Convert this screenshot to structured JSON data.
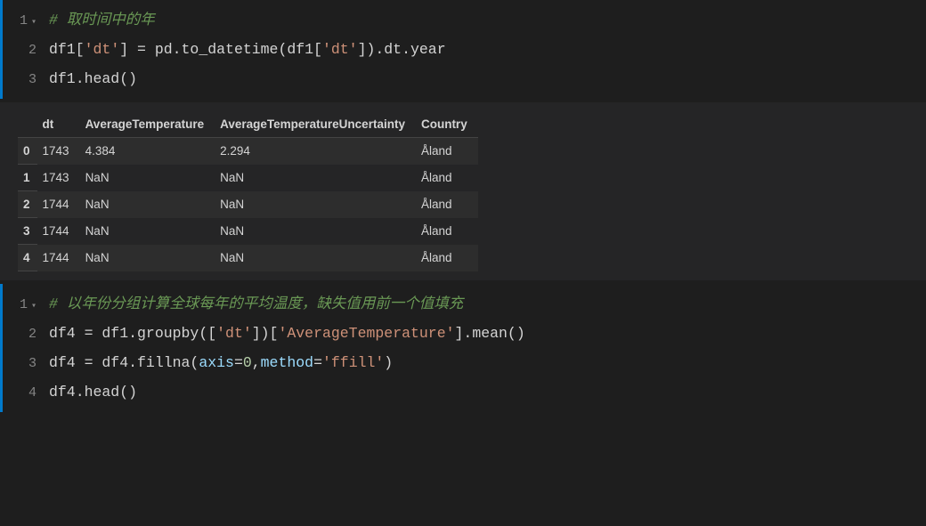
{
  "cell1": {
    "lines": [
      {
        "n": "1",
        "fold": "▾",
        "tokens": [
          {
            "cls": "c-comment",
            "t": "# 取时间中的年"
          }
        ]
      },
      {
        "n": "2",
        "fold": "",
        "tokens": [
          {
            "cls": "c-text",
            "t": "df1["
          },
          {
            "cls": "c-string",
            "t": "'dt'"
          },
          {
            "cls": "c-text",
            "t": "] = pd.to_datetime(df1["
          },
          {
            "cls": "c-string",
            "t": "'dt'"
          },
          {
            "cls": "c-text",
            "t": "]).dt.year"
          }
        ]
      },
      {
        "n": "3",
        "fold": "",
        "tokens": [
          {
            "cls": "c-text",
            "t": "df1.head()"
          }
        ]
      }
    ]
  },
  "table": {
    "headers": [
      "dt",
      "AverageTemperature",
      "AverageTemperatureUncertainty",
      "Country"
    ],
    "rows": [
      {
        "idx": "0",
        "cells": [
          "1743",
          "4.384",
          "2.294",
          "Åland"
        ]
      },
      {
        "idx": "1",
        "cells": [
          "1743",
          "NaN",
          "NaN",
          "Åland"
        ]
      },
      {
        "idx": "2",
        "cells": [
          "1744",
          "NaN",
          "NaN",
          "Åland"
        ]
      },
      {
        "idx": "3",
        "cells": [
          "1744",
          "NaN",
          "NaN",
          "Åland"
        ]
      },
      {
        "idx": "4",
        "cells": [
          "1744",
          "NaN",
          "NaN",
          "Åland"
        ]
      }
    ]
  },
  "cell2": {
    "lines": [
      {
        "n": "1",
        "fold": "▾",
        "tokens": [
          {
            "cls": "c-comment",
            "t": "# 以年份分组计算全球每年的平均温度，缺失值用前一个值填充"
          }
        ]
      },
      {
        "n": "2",
        "fold": "",
        "tokens": [
          {
            "cls": "c-text",
            "t": "df4 = df1.groupby(["
          },
          {
            "cls": "c-string",
            "t": "'dt'"
          },
          {
            "cls": "c-text",
            "t": "])["
          },
          {
            "cls": "c-string",
            "t": "'AverageTemperature'"
          },
          {
            "cls": "c-text",
            "t": "].mean()"
          }
        ]
      },
      {
        "n": "3",
        "fold": "",
        "tokens": [
          {
            "cls": "c-text",
            "t": "df4 = df4.fillna("
          },
          {
            "cls": "c-param",
            "t": "axis"
          },
          {
            "cls": "c-text",
            "t": "="
          },
          {
            "cls": "c-num",
            "t": "0"
          },
          {
            "cls": "c-text",
            "t": ","
          },
          {
            "cls": "c-param",
            "t": "method"
          },
          {
            "cls": "c-text",
            "t": "="
          },
          {
            "cls": "c-string",
            "t": "'ffill'"
          },
          {
            "cls": "c-text",
            "t": ")"
          }
        ]
      },
      {
        "n": "4",
        "fold": "",
        "tokens": [
          {
            "cls": "c-text",
            "t": "df4.head()"
          }
        ]
      }
    ]
  }
}
